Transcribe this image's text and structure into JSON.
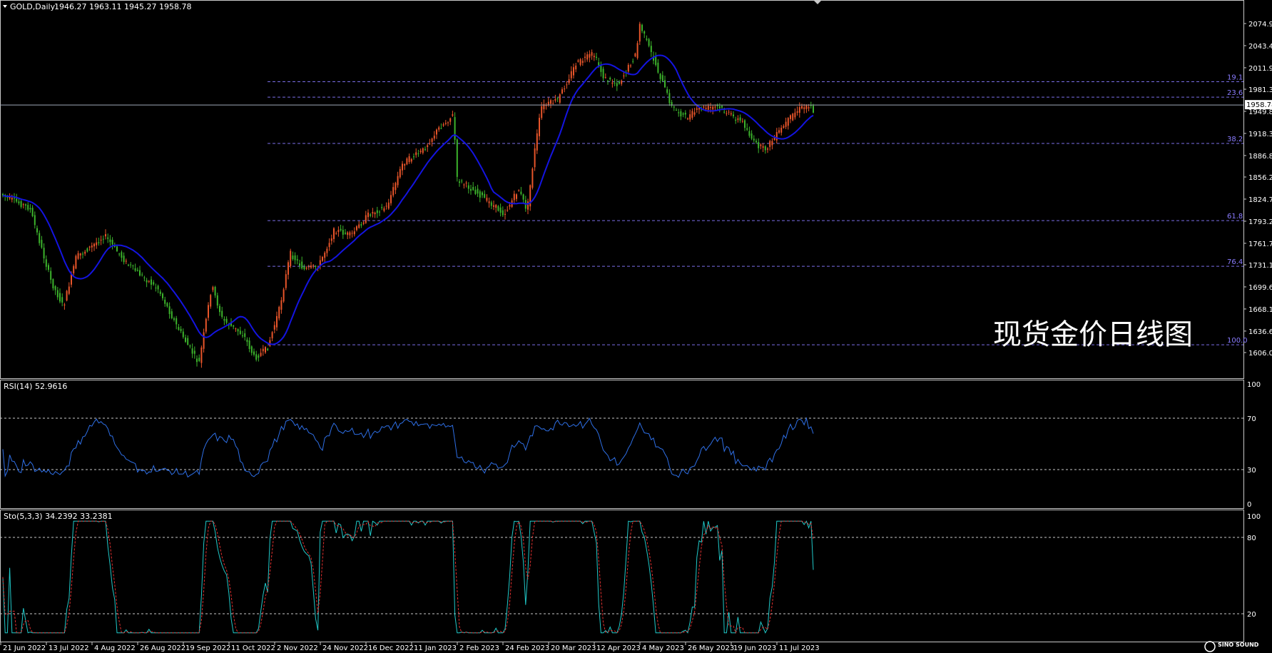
{
  "symbol_header": {
    "symbol": "GOLD,Daily",
    "ohlc": "1946.27 1963.11 1945.27 1958.78"
  },
  "watermark_text": "现货金价日线图",
  "brand_text": "SINO SOUND",
  "current_price": "1958.78",
  "price_axis_labels": [
    "2074.90",
    "2043.40",
    "2011.90",
    "1981.30",
    "1949.80",
    "1918.30",
    "1886.80",
    "1856.20",
    "1824.70",
    "1793.20",
    "1761.70",
    "1731.10",
    "1699.60",
    "1668.10",
    "1636.60",
    "1606.00"
  ],
  "fib_levels": [
    {
      "label": "19.1",
      "price": 1992
    },
    {
      "label": "23.6",
      "price": 1970
    },
    {
      "label": "38.2",
      "price": 1904
    },
    {
      "label": "61.8",
      "price": 1794
    },
    {
      "label": "76.4",
      "price": 1729
    },
    {
      "label": "100.0",
      "price": 1617
    }
  ],
  "rsi": {
    "title": "RSI(14) 52.9616",
    "levels": [
      "100",
      "70",
      "30",
      "0"
    ]
  },
  "stoch": {
    "title": "Sto(5,3,3) 34.2392 33.2381",
    "levels": [
      "100",
      "80",
      "20"
    ]
  },
  "date_labels": [
    "21 Jun 2022",
    "13 Jul 2022",
    "4 Aug 2022",
    "26 Aug 2022",
    "19 Sep 2022",
    "11 Oct 2022",
    "2 Nov 2022",
    "24 Nov 2022",
    "16 Dec 2022",
    "11 Jan 2023",
    "2 Feb 2023",
    "24 Feb 2023",
    "20 Mar 2023",
    "12 Apr 2023",
    "4 May 2023",
    "26 May 2023",
    "19 Jun 2023",
    "11 Jul 2023"
  ],
  "colors": {
    "background": "#000000",
    "bull_candle": "#e8552a",
    "bear_candle": "#3cb32c",
    "moving_average": "#1414e0",
    "rsi_line": "#2e6fe6",
    "stoch_main": "#20c8c8",
    "stoch_signal": "#e03030",
    "fib_line": "#7a6ee6",
    "panel_border": "#c8c8c8",
    "level_dotted": "#c8c8c8",
    "current_price_line": "#a0a8b8"
  }
}
